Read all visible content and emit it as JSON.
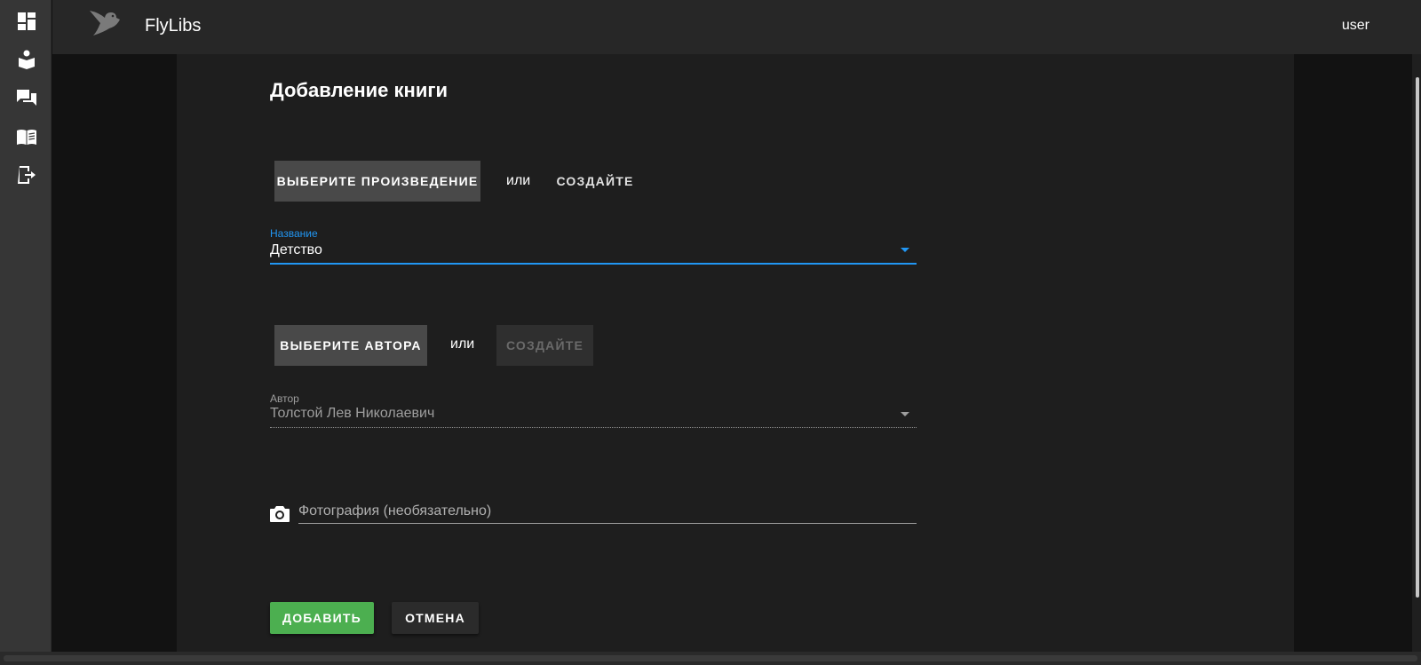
{
  "app": {
    "title": "FlyLibs",
    "user": "user"
  },
  "sidebar": {
    "items": [
      {
        "icon": "dashboard-icon"
      },
      {
        "icon": "reader-icon"
      },
      {
        "icon": "forum-icon"
      },
      {
        "icon": "book-icon"
      },
      {
        "icon": "logout-icon"
      }
    ]
  },
  "form": {
    "title": "Добавление книги",
    "work": {
      "select_label": "Выберите произведение",
      "or_label": "или",
      "create_label": "Создайте",
      "field_label": "Название",
      "field_value": "Детство"
    },
    "author": {
      "select_label": "Выберите автора",
      "or_label": "или",
      "create_label": "Создайте",
      "field_label": "Автор",
      "field_value": "Толстой Лев Николаевич"
    },
    "photo": {
      "placeholder": "Фотография (необязательно)",
      "icon": "camera-icon"
    },
    "actions": {
      "add_label": "ДОБАВИТЬ",
      "cancel_label": "ОТМЕНА"
    }
  },
  "colors": {
    "accent": "#2196f3",
    "success": "#4caf50",
    "background": "#1e1e1e",
    "topbar": "#272727",
    "sidebar": "#363636"
  }
}
